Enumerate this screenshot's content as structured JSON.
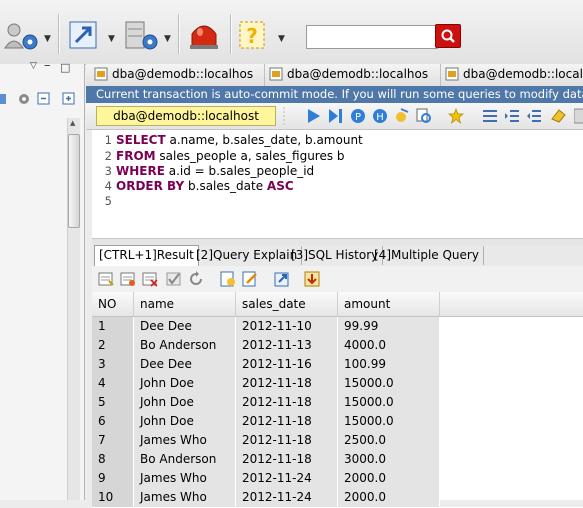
{
  "toolbar": {
    "search_value": "",
    "colors": {
      "stop": "#d42a14",
      "help": "#f2b000",
      "search_button": "#cc1111"
    }
  },
  "editor_tabs": [
    {
      "label": "dba@demodb::localhos"
    },
    {
      "label": "dba@demodb::localhos"
    },
    {
      "label": "dba@demodb::localhos"
    }
  ],
  "transaction_message": "Current transaction is auto-commit mode. If you will run some queries to modify data, it will",
  "sql_toolbar": {
    "connection": "dba@demodb::localhost"
  },
  "editor": {
    "lines": [
      {
        "n": "1",
        "parts": [
          {
            "kw": "SELECT",
            "text": " a.name, b.sales_date, b.amount"
          }
        ]
      },
      {
        "n": "2",
        "parts": [
          {
            "kw": "FROM",
            "text": " sales_people a, sales_figures b"
          }
        ]
      },
      {
        "n": "3",
        "parts": [
          {
            "kw": "WHERE",
            "text": " a.id = b.sales_people_id"
          }
        ]
      },
      {
        "n": "4",
        "parts": [
          {
            "kw": "ORDER BY",
            "text": " b.sales_date "
          },
          {
            "kw": "ASC",
            "text": ""
          }
        ]
      },
      {
        "n": "5",
        "parts": []
      }
    ]
  },
  "result_tabs": [
    {
      "label": "[CTRL+1]Result",
      "active": true
    },
    {
      "label": "[2]Query Explain",
      "active": false
    },
    {
      "label": "[3]SQL History",
      "active": false
    },
    {
      "label": "[4]Multiple Query",
      "active": false
    }
  ],
  "grid": {
    "columns": [
      "NO",
      "name",
      "sales_date",
      "amount"
    ],
    "rows": [
      [
        "1",
        "Dee Dee",
        "2012-11-10",
        "99.99"
      ],
      [
        "2",
        "Bo Anderson",
        "2012-11-13",
        "4000.0"
      ],
      [
        "3",
        "Dee Dee",
        "2012-11-16",
        "100.99"
      ],
      [
        "4",
        "John Doe",
        "2012-11-18",
        "15000.0"
      ],
      [
        "5",
        "John Doe",
        "2012-11-18",
        "15000.0"
      ],
      [
        "6",
        "John Doe",
        "2012-11-18",
        "15000.0"
      ],
      [
        "7",
        "James Who",
        "2012-11-18",
        "2500.0"
      ],
      [
        "8",
        "Bo Anderson",
        "2012-11-18",
        "3000.0"
      ],
      [
        "9",
        "James Who",
        "2012-11-24",
        "2000.0"
      ],
      [
        "10",
        "James Who",
        "2012-11-24",
        "2000.0"
      ]
    ]
  }
}
